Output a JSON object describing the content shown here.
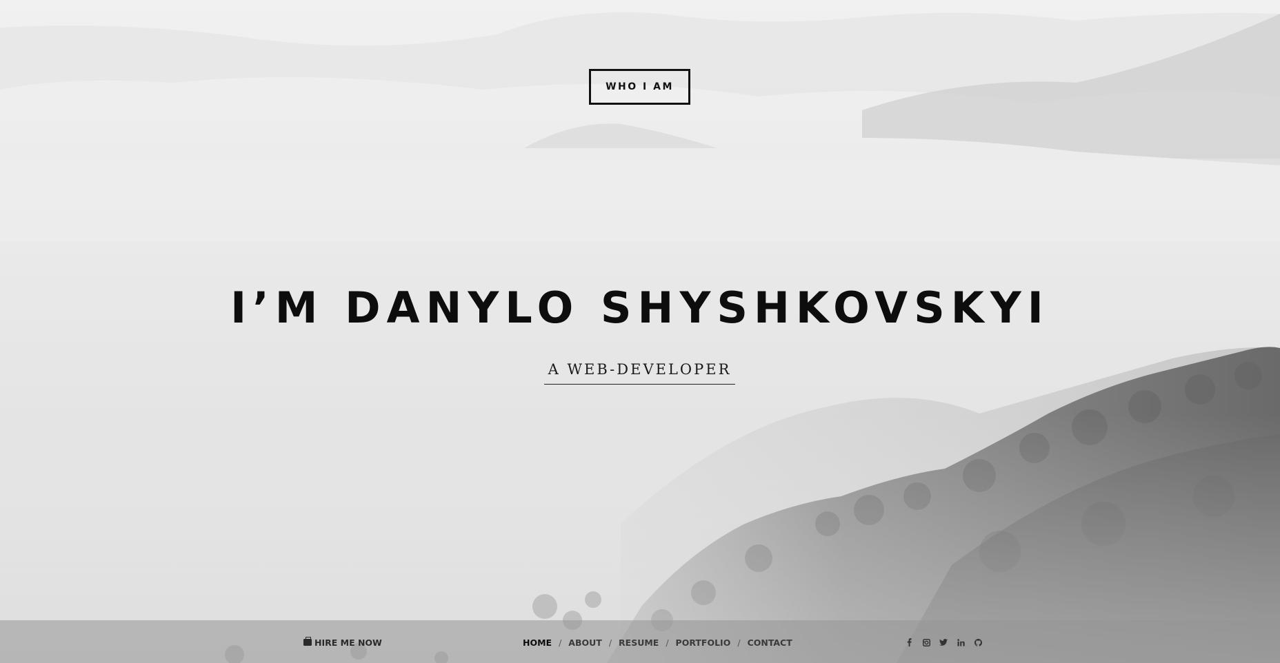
{
  "hero": {
    "button_label": "WHO I AM",
    "headline": "I’M DANYLO SHYSHKOVSKYI",
    "subtitle": "A WEB-DEVELOPER"
  },
  "footer": {
    "hire_label": "HIRE ME NOW",
    "hire_icon": "briefcase-icon",
    "nav": [
      {
        "label": "HOME",
        "active": true
      },
      {
        "label": "ABOUT",
        "active": false
      },
      {
        "label": "RESUME",
        "active": false
      },
      {
        "label": "PORTFOLIO",
        "active": false
      },
      {
        "label": "CONTACT",
        "active": false
      }
    ],
    "nav_separator": "/",
    "social_icons": [
      "facebook-icon",
      "instagram-icon",
      "twitter-icon",
      "linkedin-icon",
      "github-icon"
    ],
    "social_glyphs": [
      "f",
      "in"
    ]
  },
  "colors": {
    "text_dark": "#0d0d0d",
    "footer_bar": "#969696"
  }
}
